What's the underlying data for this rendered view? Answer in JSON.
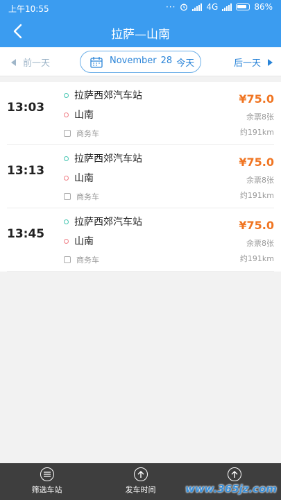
{
  "status": {
    "time": "上午10:55",
    "icons": [
      "dots-icon",
      "alarm-icon",
      "signal-icon",
      "4g-icon",
      "battery-icon"
    ],
    "network": "4G",
    "battery": "86%"
  },
  "header": {
    "title": "拉萨—山南"
  },
  "datebar": {
    "prev_label": "前一天",
    "next_label": "后一天",
    "date_month": "November",
    "date_day": "28",
    "date_today": "今天"
  },
  "trips": [
    {
      "time": "13:03",
      "from": "拉萨西郊汽车站",
      "to": "山南",
      "bus_type": "商务车",
      "price": "¥75.0",
      "tickets": "余票8张",
      "distance": "约191km"
    },
    {
      "time": "13:13",
      "from": "拉萨西郊汽车站",
      "to": "山南",
      "bus_type": "商务车",
      "price": "¥75.0",
      "tickets": "余票8张",
      "distance": "约191km"
    },
    {
      "time": "13:45",
      "from": "拉萨西郊汽车站",
      "to": "山南",
      "bus_type": "商务车",
      "price": "¥75.0",
      "tickets": "余票8张",
      "distance": "约191km"
    }
  ],
  "bottom": {
    "tabs": [
      {
        "label": "筛选车站",
        "icon": "filter-icon"
      },
      {
        "label": "发车时间",
        "icon": "arrow-up-icon"
      },
      {
        "label": "价格",
        "icon": "arrow-up-icon"
      }
    ]
  },
  "watermark": "www.365jz.com",
  "colors": {
    "primary": "#3b9cf0",
    "price": "#f07522",
    "bottom_bar": "#3e3e3e"
  }
}
